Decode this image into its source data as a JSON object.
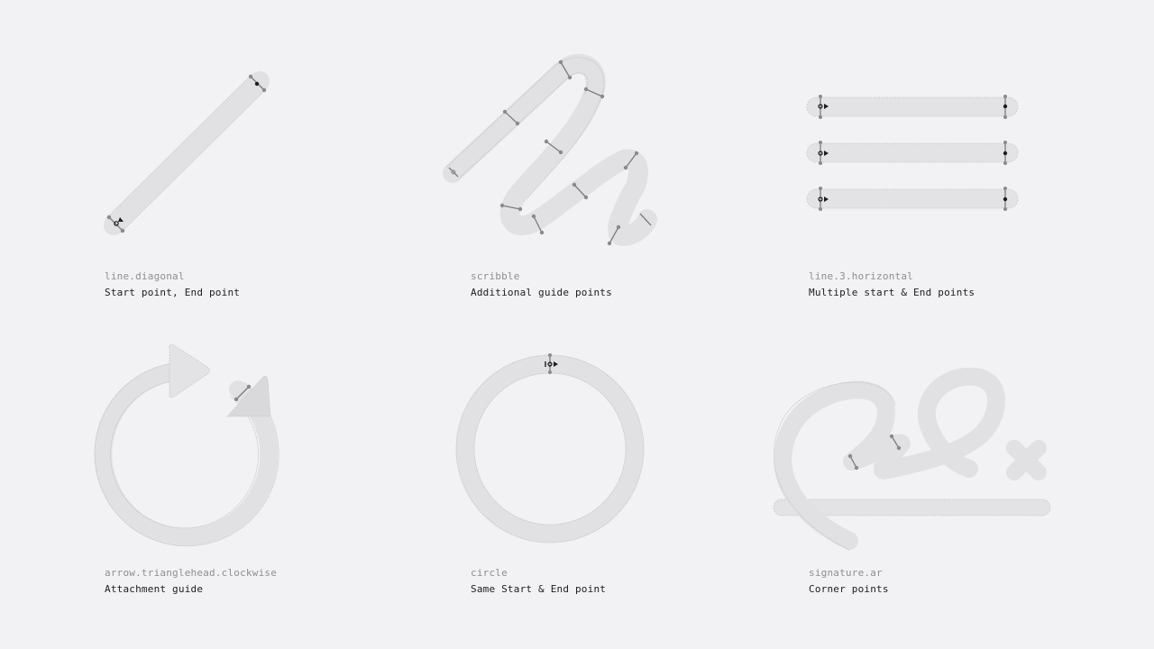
{
  "symbols": [
    {
      "name": "line.diagonal",
      "description": "Start point, End point"
    },
    {
      "name": "scribble",
      "description": "Additional guide points"
    },
    {
      "name": "line.3.horizontal",
      "description": "Multiple start & End points"
    },
    {
      "name": "arrow.trianglehead.clockwise",
      "description": "Attachment guide"
    },
    {
      "name": "circle",
      "description": "Same Start & End point"
    },
    {
      "name": "signature.ar",
      "description": "Corner points"
    }
  ]
}
